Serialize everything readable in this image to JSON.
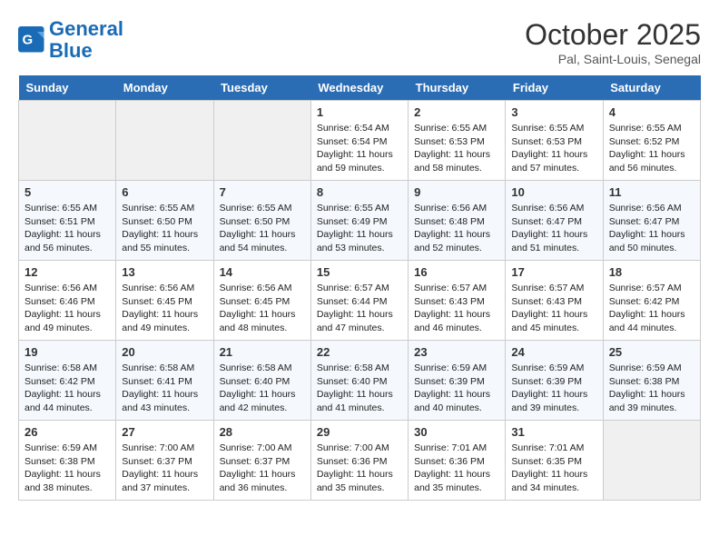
{
  "header": {
    "logo_line1": "General",
    "logo_line2": "Blue",
    "month": "October 2025",
    "location": "Pal, Saint-Louis, Senegal"
  },
  "days_of_week": [
    "Sunday",
    "Monday",
    "Tuesday",
    "Wednesday",
    "Thursday",
    "Friday",
    "Saturday"
  ],
  "weeks": [
    [
      {
        "day": "",
        "info": ""
      },
      {
        "day": "",
        "info": ""
      },
      {
        "day": "",
        "info": ""
      },
      {
        "day": "1",
        "info": "Sunrise: 6:54 AM\nSunset: 6:54 PM\nDaylight: 11 hours\nand 59 minutes."
      },
      {
        "day": "2",
        "info": "Sunrise: 6:55 AM\nSunset: 6:53 PM\nDaylight: 11 hours\nand 58 minutes."
      },
      {
        "day": "3",
        "info": "Sunrise: 6:55 AM\nSunset: 6:53 PM\nDaylight: 11 hours\nand 57 minutes."
      },
      {
        "day": "4",
        "info": "Sunrise: 6:55 AM\nSunset: 6:52 PM\nDaylight: 11 hours\nand 56 minutes."
      }
    ],
    [
      {
        "day": "5",
        "info": "Sunrise: 6:55 AM\nSunset: 6:51 PM\nDaylight: 11 hours\nand 56 minutes."
      },
      {
        "day": "6",
        "info": "Sunrise: 6:55 AM\nSunset: 6:50 PM\nDaylight: 11 hours\nand 55 minutes."
      },
      {
        "day": "7",
        "info": "Sunrise: 6:55 AM\nSunset: 6:50 PM\nDaylight: 11 hours\nand 54 minutes."
      },
      {
        "day": "8",
        "info": "Sunrise: 6:55 AM\nSunset: 6:49 PM\nDaylight: 11 hours\nand 53 minutes."
      },
      {
        "day": "9",
        "info": "Sunrise: 6:56 AM\nSunset: 6:48 PM\nDaylight: 11 hours\nand 52 minutes."
      },
      {
        "day": "10",
        "info": "Sunrise: 6:56 AM\nSunset: 6:47 PM\nDaylight: 11 hours\nand 51 minutes."
      },
      {
        "day": "11",
        "info": "Sunrise: 6:56 AM\nSunset: 6:47 PM\nDaylight: 11 hours\nand 50 minutes."
      }
    ],
    [
      {
        "day": "12",
        "info": "Sunrise: 6:56 AM\nSunset: 6:46 PM\nDaylight: 11 hours\nand 49 minutes."
      },
      {
        "day": "13",
        "info": "Sunrise: 6:56 AM\nSunset: 6:45 PM\nDaylight: 11 hours\nand 49 minutes."
      },
      {
        "day": "14",
        "info": "Sunrise: 6:56 AM\nSunset: 6:45 PM\nDaylight: 11 hours\nand 48 minutes."
      },
      {
        "day": "15",
        "info": "Sunrise: 6:57 AM\nSunset: 6:44 PM\nDaylight: 11 hours\nand 47 minutes."
      },
      {
        "day": "16",
        "info": "Sunrise: 6:57 AM\nSunset: 6:43 PM\nDaylight: 11 hours\nand 46 minutes."
      },
      {
        "day": "17",
        "info": "Sunrise: 6:57 AM\nSunset: 6:43 PM\nDaylight: 11 hours\nand 45 minutes."
      },
      {
        "day": "18",
        "info": "Sunrise: 6:57 AM\nSunset: 6:42 PM\nDaylight: 11 hours\nand 44 minutes."
      }
    ],
    [
      {
        "day": "19",
        "info": "Sunrise: 6:58 AM\nSunset: 6:42 PM\nDaylight: 11 hours\nand 44 minutes."
      },
      {
        "day": "20",
        "info": "Sunrise: 6:58 AM\nSunset: 6:41 PM\nDaylight: 11 hours\nand 43 minutes."
      },
      {
        "day": "21",
        "info": "Sunrise: 6:58 AM\nSunset: 6:40 PM\nDaylight: 11 hours\nand 42 minutes."
      },
      {
        "day": "22",
        "info": "Sunrise: 6:58 AM\nSunset: 6:40 PM\nDaylight: 11 hours\nand 41 minutes."
      },
      {
        "day": "23",
        "info": "Sunrise: 6:59 AM\nSunset: 6:39 PM\nDaylight: 11 hours\nand 40 minutes."
      },
      {
        "day": "24",
        "info": "Sunrise: 6:59 AM\nSunset: 6:39 PM\nDaylight: 11 hours\nand 39 minutes."
      },
      {
        "day": "25",
        "info": "Sunrise: 6:59 AM\nSunset: 6:38 PM\nDaylight: 11 hours\nand 39 minutes."
      }
    ],
    [
      {
        "day": "26",
        "info": "Sunrise: 6:59 AM\nSunset: 6:38 PM\nDaylight: 11 hours\nand 38 minutes."
      },
      {
        "day": "27",
        "info": "Sunrise: 7:00 AM\nSunset: 6:37 PM\nDaylight: 11 hours\nand 37 minutes."
      },
      {
        "day": "28",
        "info": "Sunrise: 7:00 AM\nSunset: 6:37 PM\nDaylight: 11 hours\nand 36 minutes."
      },
      {
        "day": "29",
        "info": "Sunrise: 7:00 AM\nSunset: 6:36 PM\nDaylight: 11 hours\nand 35 minutes."
      },
      {
        "day": "30",
        "info": "Sunrise: 7:01 AM\nSunset: 6:36 PM\nDaylight: 11 hours\nand 35 minutes."
      },
      {
        "day": "31",
        "info": "Sunrise: 7:01 AM\nSunset: 6:35 PM\nDaylight: 11 hours\nand 34 minutes."
      },
      {
        "day": "",
        "info": ""
      }
    ]
  ]
}
